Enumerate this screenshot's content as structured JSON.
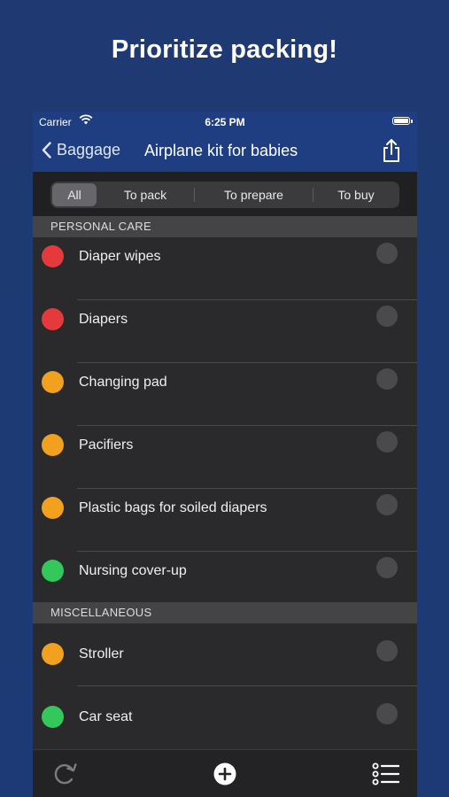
{
  "headline": "Prioritize packing!",
  "status_bar": {
    "carrier": "Carrier",
    "time": "6:25 PM"
  },
  "nav": {
    "back_label": "Baggage",
    "title": "Airplane kit for babies"
  },
  "segments": [
    "All",
    "To pack",
    "To prepare",
    "To buy"
  ],
  "sections": [
    {
      "title": "PERSONAL CARE",
      "items": [
        {
          "label": "Diaper wipes",
          "priority_color": "#e5393b"
        },
        {
          "label": "Diapers",
          "priority_color": "#e5393b"
        },
        {
          "label": "Changing pad",
          "priority_color": "#f1a11d"
        },
        {
          "label": "Pacifiers",
          "priority_color": "#f1a11d"
        },
        {
          "label": "Plastic bags for soiled diapers",
          "priority_color": "#f1a11d"
        },
        {
          "label": "Nursing cover-up",
          "priority_color": "#34c759"
        }
      ]
    },
    {
      "title": "MISCELLANEOUS",
      "items": [
        {
          "label": "Stroller",
          "priority_color": "#f1a11d"
        },
        {
          "label": "Car seat",
          "priority_color": "#34c759"
        }
      ]
    }
  ],
  "colors": {
    "background": "#1f3a72",
    "nav_bar": "#1f3e82",
    "list_bg": "#2a2a2c",
    "section_bg": "#444446"
  },
  "icons": {
    "toolbar_left": "reset-icon",
    "toolbar_center": "add-icon",
    "toolbar_right": "list-icon",
    "nav_right": "share-icon"
  }
}
